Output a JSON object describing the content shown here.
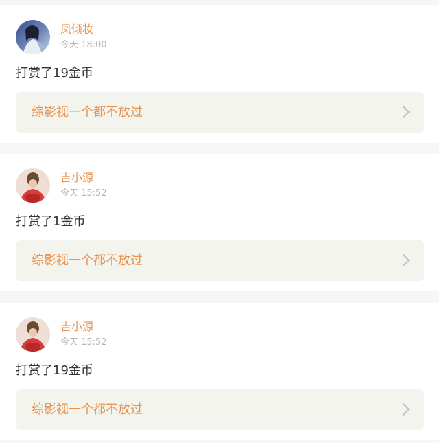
{
  "feed": {
    "items": [
      {
        "username": "凤倾妆",
        "time": "今天 18:00",
        "message": "打赏了19金币",
        "book_title": "综影视一个都不放过"
      },
      {
        "username": "吉小源",
        "time": "今天 15:52",
        "message": "打赏了1金币",
        "book_title": "综影视一个都不放过"
      },
      {
        "username": "吉小源",
        "time": "今天 15:52",
        "message": "打赏了19金币",
        "book_title": "综影视一个都不放过"
      }
    ]
  },
  "colors": {
    "accent": "#e8934e",
    "muted": "#b4b4b4",
    "text": "#333333",
    "book_bg": "#f4f4ef",
    "page_bg": "#f6f6f6"
  },
  "icons": {
    "chevron": "chevron-right-icon",
    "avatar": "avatar"
  }
}
